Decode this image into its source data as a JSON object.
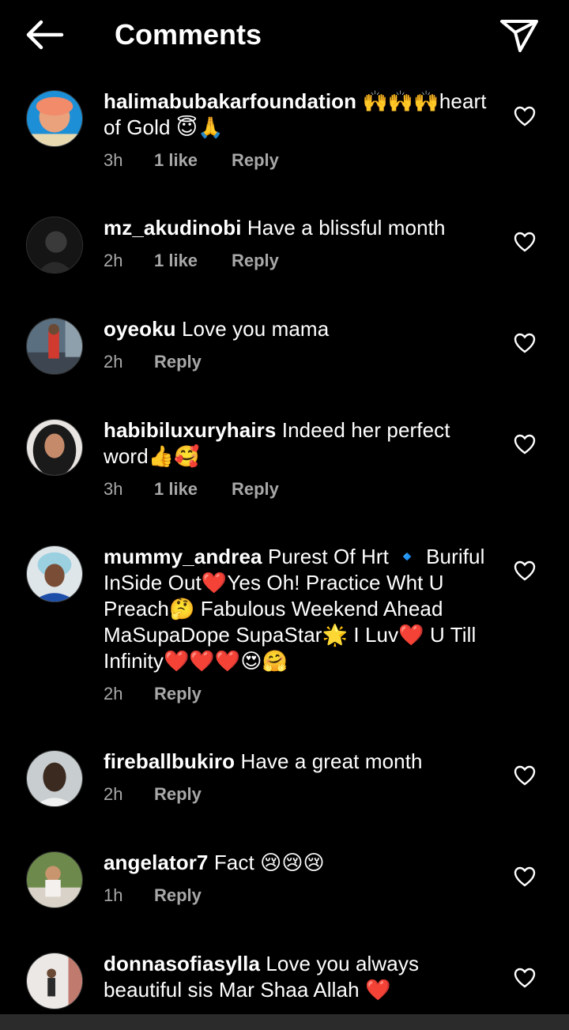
{
  "header": {
    "title": "Comments",
    "back_icon": "arrow-left-icon",
    "share_icon": "paper-plane-icon"
  },
  "comments": [
    {
      "username": "halimabubakarfoundation",
      "text": "🙌🙌🙌heart of Gold 😇🙏",
      "time": "3h",
      "likes": "1 like",
      "reply": "Reply"
    },
    {
      "username": "mz_akudinobi",
      "text": "Have a blissful month",
      "time": "2h",
      "likes": "1 like",
      "reply": "Reply"
    },
    {
      "username": "oyeoku",
      "text": "Love you mama",
      "time": "2h",
      "likes": "",
      "reply": "Reply"
    },
    {
      "username": "habibiluxuryhairs",
      "text": "Indeed her perfect word👍🥰",
      "time": "3h",
      "likes": "1 like",
      "reply": "Reply"
    },
    {
      "username": "mummy_andrea",
      "text": "Purest Of Hrt 🔹 Buriful InSide Out❤️Yes Oh! Practice Wht U Preach🤔 Fabulous Weekend Ahead MaSupaDope SupaStar🌟 I Luv❤️ U Till Infinity❤️❤️❤️😍🤗",
      "time": "2h",
      "likes": "",
      "reply": "Reply"
    },
    {
      "username": "fireballbukiro",
      "text": "Have a great month",
      "time": "2h",
      "likes": "",
      "reply": "Reply"
    },
    {
      "username": "angelator7",
      "text": "Fact 😢😢😢",
      "time": "1h",
      "likes": "",
      "reply": "Reply"
    },
    {
      "username": "donnasofiasylla",
      "text": "Love you always beautiful sis Mar Shaa Allah ❤️",
      "time": "",
      "likes": "",
      "reply": ""
    }
  ],
  "colors": {
    "background": "#000000",
    "text": "#ffffff",
    "meta": "#a8a8a8"
  }
}
